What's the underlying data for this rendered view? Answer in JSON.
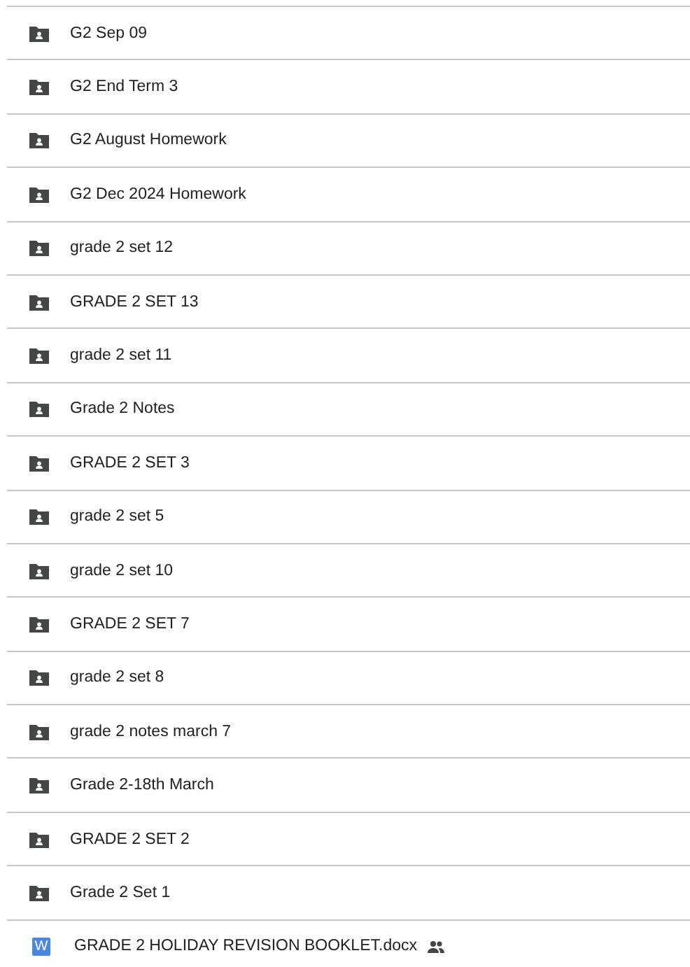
{
  "items": [
    {
      "kind": "folder",
      "name": "G2 Sep 09",
      "shared": false
    },
    {
      "kind": "folder",
      "name": "G2 End Term 3",
      "shared": false
    },
    {
      "kind": "folder",
      "name": "G2 August Homework",
      "shared": false
    },
    {
      "kind": "folder",
      "name": "G2 Dec 2024 Homework",
      "shared": false
    },
    {
      "kind": "folder",
      "name": "grade 2 set 12",
      "shared": false
    },
    {
      "kind": "folder",
      "name": "GRADE 2 SET 13",
      "shared": false
    },
    {
      "kind": "folder",
      "name": "grade 2 set 11",
      "shared": false
    },
    {
      "kind": "folder",
      "name": "Grade 2 Notes",
      "shared": false
    },
    {
      "kind": "folder",
      "name": "GRADE 2 SET 3",
      "shared": false
    },
    {
      "kind": "folder",
      "name": "grade 2 set 5",
      "shared": false
    },
    {
      "kind": "folder",
      "name": "grade 2 set 10",
      "shared": false
    },
    {
      "kind": "folder",
      "name": "GRADE 2 SET 7",
      "shared": false
    },
    {
      "kind": "folder",
      "name": "grade 2 set 8",
      "shared": false
    },
    {
      "kind": "folder",
      "name": "grade 2 notes march 7",
      "shared": false
    },
    {
      "kind": "folder",
      "name": "Grade 2-18th March",
      "shared": false
    },
    {
      "kind": "folder",
      "name": "GRADE 2 SET 2",
      "shared": false
    },
    {
      "kind": "folder",
      "name": "Grade 2 Set 1",
      "shared": false
    },
    {
      "kind": "document",
      "name": "GRADE 2 HOLIDAY REVISION BOOKLET.docx",
      "icon_letter": "W",
      "shared": true
    }
  ]
}
